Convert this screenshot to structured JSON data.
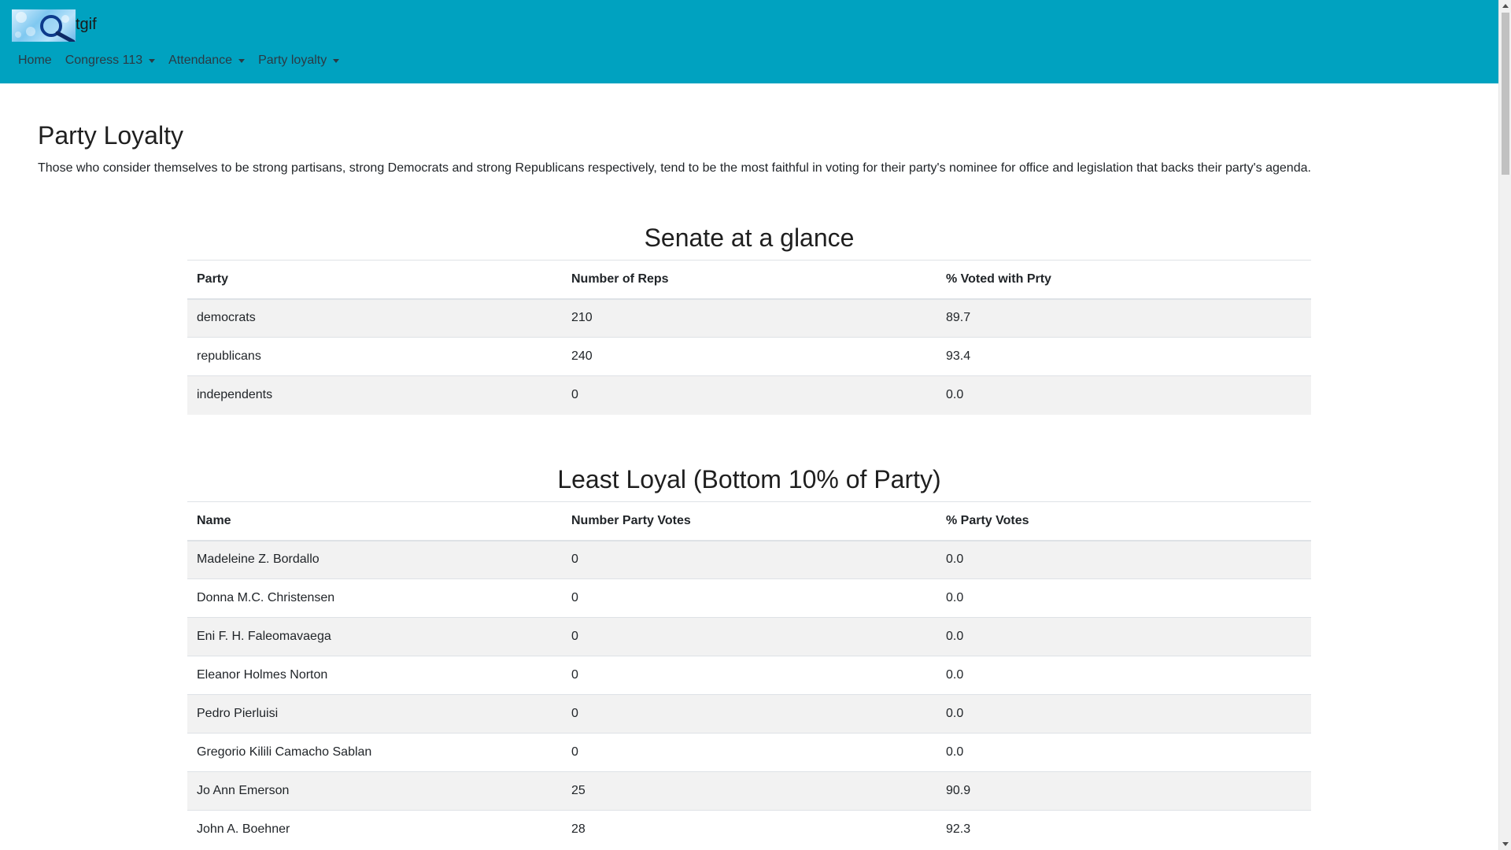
{
  "navbar": {
    "brand": "tgif",
    "logo_icon": "magnifier-logo-icon",
    "items": [
      {
        "label": "Home",
        "dropdown": false
      },
      {
        "label": "Congress 113",
        "dropdown": true
      },
      {
        "label": "Attendance",
        "dropdown": true
      },
      {
        "label": "Party loyalty",
        "dropdown": true
      }
    ],
    "background": "#00a2c0"
  },
  "main": {
    "title": "Party Loyalty",
    "intro": "Those who consider themselves to be strong partisans, strong Democrats and strong Republicans respectively, tend to be the most faithful in voting for their party's nominee for office and legislation that backs their party's agenda."
  },
  "glance": {
    "title": "Senate at a glance",
    "headers": [
      "Party",
      "Number of Reps",
      "% Voted with Prty"
    ],
    "rows": [
      [
        "democrats",
        "210",
        "89.7"
      ],
      [
        "republicans",
        "240",
        "93.4"
      ],
      [
        "independents",
        "0",
        "0.0"
      ]
    ]
  },
  "least_loyal": {
    "title": "Least Loyal (Bottom 10% of Party)",
    "headers": [
      "Name",
      "Number Party Votes",
      "% Party Votes"
    ],
    "rows": [
      [
        "Madeleine Z. Bordallo",
        "0",
        "0.0"
      ],
      [
        "Donna M.C. Christensen",
        "0",
        "0.0"
      ],
      [
        "Eni F. H. Faleomavaega",
        "0",
        "0.0"
      ],
      [
        "Eleanor Holmes Norton",
        "0",
        "0.0"
      ],
      [
        "Pedro Pierluisi",
        "0",
        "0.0"
      ],
      [
        "Gregorio Kilili Camacho Sablan",
        "0",
        "0.0"
      ],
      [
        "Jo Ann Emerson",
        "25",
        "90.9"
      ],
      [
        "John A. Boehner",
        "28",
        "92.3"
      ]
    ]
  }
}
